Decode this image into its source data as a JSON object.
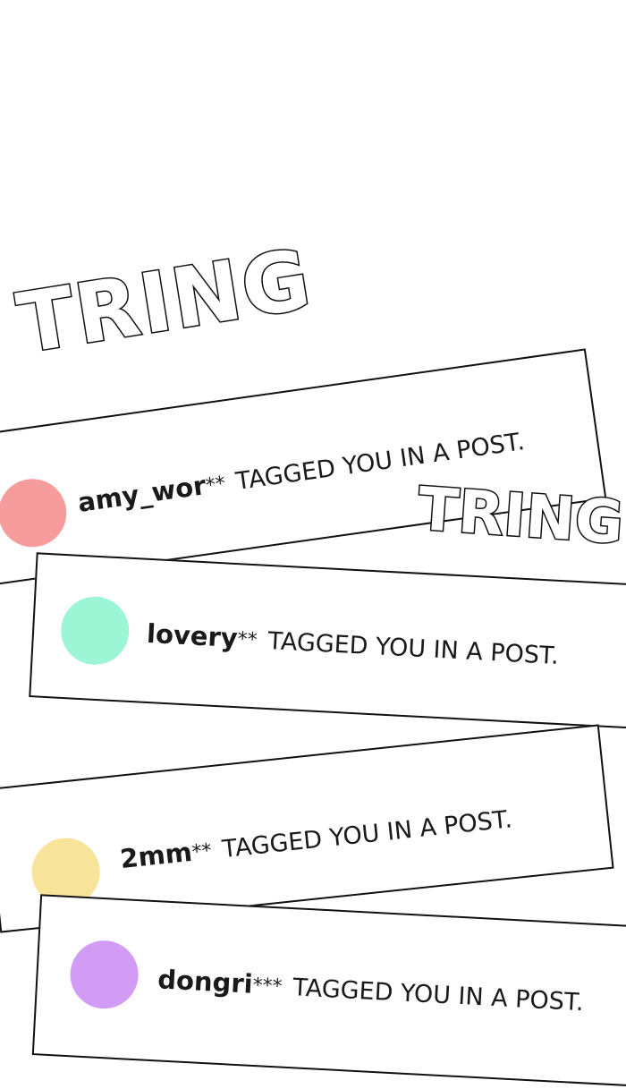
{
  "sfx": {
    "top": "TRING",
    "middle": "TRING"
  },
  "notifications": [
    {
      "username": "amy_wor",
      "stars": "**",
      "message": "TAGGED YOU IN A POST.",
      "avatar_color": "#f79c9c"
    },
    {
      "username": "lovery",
      "stars": "**",
      "message": "TAGGED YOU IN A POST.",
      "avatar_color": "#9cf5d4"
    },
    {
      "username": "2mm",
      "stars": "**",
      "message": "TAGGED YOU IN A POST.",
      "avatar_color": "#f7e39a"
    },
    {
      "username": "dongri",
      "stars": "***",
      "message": "TAGGED YOU IN A POST.",
      "avatar_color": "#d29cf5"
    }
  ]
}
